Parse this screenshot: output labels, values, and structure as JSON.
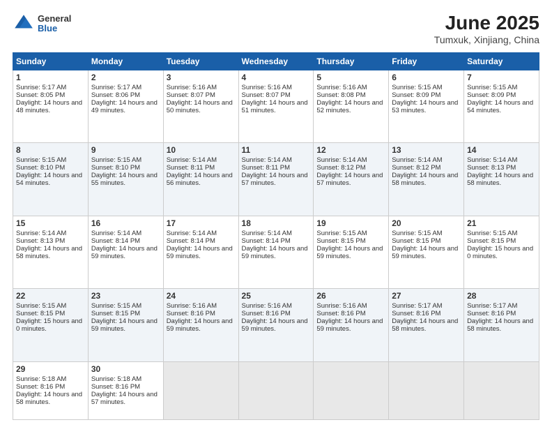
{
  "header": {
    "logo": {
      "general": "General",
      "blue": "Blue"
    },
    "title": "June 2025",
    "location": "Tumxuk, Xinjiang, China"
  },
  "weekdays": [
    "Sunday",
    "Monday",
    "Tuesday",
    "Wednesday",
    "Thursday",
    "Friday",
    "Saturday"
  ],
  "weeks": [
    [
      {
        "day": "1",
        "sunrise": "5:17 AM",
        "sunset": "8:05 PM",
        "daylight": "14 hours and 48 minutes."
      },
      {
        "day": "2",
        "sunrise": "5:17 AM",
        "sunset": "8:06 PM",
        "daylight": "14 hours and 49 minutes."
      },
      {
        "day": "3",
        "sunrise": "5:16 AM",
        "sunset": "8:07 PM",
        "daylight": "14 hours and 50 minutes."
      },
      {
        "day": "4",
        "sunrise": "5:16 AM",
        "sunset": "8:07 PM",
        "daylight": "14 hours and 51 minutes."
      },
      {
        "day": "5",
        "sunrise": "5:16 AM",
        "sunset": "8:08 PM",
        "daylight": "14 hours and 52 minutes."
      },
      {
        "day": "6",
        "sunrise": "5:15 AM",
        "sunset": "8:09 PM",
        "daylight": "14 hours and 53 minutes."
      },
      {
        "day": "7",
        "sunrise": "5:15 AM",
        "sunset": "8:09 PM",
        "daylight": "14 hours and 54 minutes."
      }
    ],
    [
      {
        "day": "8",
        "sunrise": "5:15 AM",
        "sunset": "8:10 PM",
        "daylight": "14 hours and 54 minutes."
      },
      {
        "day": "9",
        "sunrise": "5:15 AM",
        "sunset": "8:10 PM",
        "daylight": "14 hours and 55 minutes."
      },
      {
        "day": "10",
        "sunrise": "5:14 AM",
        "sunset": "8:11 PM",
        "daylight": "14 hours and 56 minutes."
      },
      {
        "day": "11",
        "sunrise": "5:14 AM",
        "sunset": "8:11 PM",
        "daylight": "14 hours and 57 minutes."
      },
      {
        "day": "12",
        "sunrise": "5:14 AM",
        "sunset": "8:12 PM",
        "daylight": "14 hours and 57 minutes."
      },
      {
        "day": "13",
        "sunrise": "5:14 AM",
        "sunset": "8:12 PM",
        "daylight": "14 hours and 58 minutes."
      },
      {
        "day": "14",
        "sunrise": "5:14 AM",
        "sunset": "8:13 PM",
        "daylight": "14 hours and 58 minutes."
      }
    ],
    [
      {
        "day": "15",
        "sunrise": "5:14 AM",
        "sunset": "8:13 PM",
        "daylight": "14 hours and 58 minutes."
      },
      {
        "day": "16",
        "sunrise": "5:14 AM",
        "sunset": "8:14 PM",
        "daylight": "14 hours and 59 minutes."
      },
      {
        "day": "17",
        "sunrise": "5:14 AM",
        "sunset": "8:14 PM",
        "daylight": "14 hours and 59 minutes."
      },
      {
        "day": "18",
        "sunrise": "5:14 AM",
        "sunset": "8:14 PM",
        "daylight": "14 hours and 59 minutes."
      },
      {
        "day": "19",
        "sunrise": "5:15 AM",
        "sunset": "8:15 PM",
        "daylight": "14 hours and 59 minutes."
      },
      {
        "day": "20",
        "sunrise": "5:15 AM",
        "sunset": "8:15 PM",
        "daylight": "14 hours and 59 minutes."
      },
      {
        "day": "21",
        "sunrise": "5:15 AM",
        "sunset": "8:15 PM",
        "daylight": "15 hours and 0 minutes."
      }
    ],
    [
      {
        "day": "22",
        "sunrise": "5:15 AM",
        "sunset": "8:15 PM",
        "daylight": "15 hours and 0 minutes."
      },
      {
        "day": "23",
        "sunrise": "5:15 AM",
        "sunset": "8:15 PM",
        "daylight": "14 hours and 59 minutes."
      },
      {
        "day": "24",
        "sunrise": "5:16 AM",
        "sunset": "8:16 PM",
        "daylight": "14 hours and 59 minutes."
      },
      {
        "day": "25",
        "sunrise": "5:16 AM",
        "sunset": "8:16 PM",
        "daylight": "14 hours and 59 minutes."
      },
      {
        "day": "26",
        "sunrise": "5:16 AM",
        "sunset": "8:16 PM",
        "daylight": "14 hours and 59 minutes."
      },
      {
        "day": "27",
        "sunrise": "5:17 AM",
        "sunset": "8:16 PM",
        "daylight": "14 hours and 58 minutes."
      },
      {
        "day": "28",
        "sunrise": "5:17 AM",
        "sunset": "8:16 PM",
        "daylight": "14 hours and 58 minutes."
      }
    ],
    [
      {
        "day": "29",
        "sunrise": "5:18 AM",
        "sunset": "8:16 PM",
        "daylight": "14 hours and 58 minutes."
      },
      {
        "day": "30",
        "sunrise": "5:18 AM",
        "sunset": "8:16 PM",
        "daylight": "14 hours and 57 minutes."
      },
      null,
      null,
      null,
      null,
      null
    ]
  ]
}
